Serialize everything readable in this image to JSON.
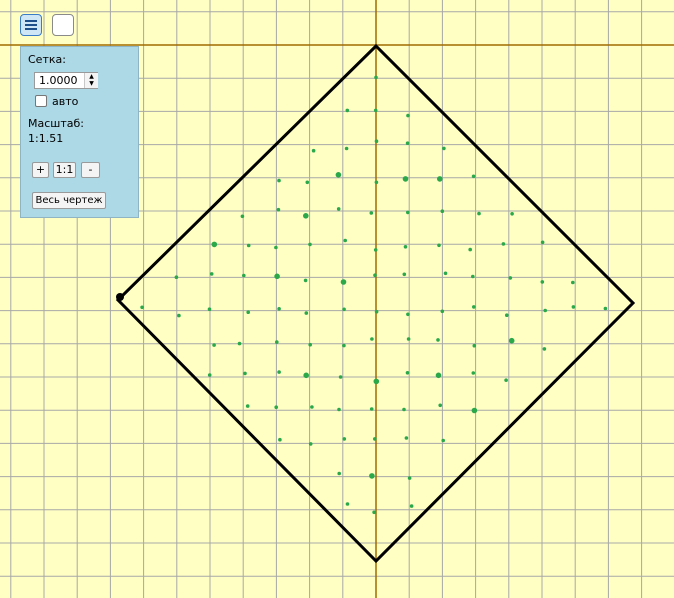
{
  "panel": {
    "grid_label": "Сетка:",
    "grid_value": "1.0000",
    "auto_label": "авто",
    "auto_checked": false,
    "scale_label": "Масштаб:",
    "scale_value": "1:1.51",
    "zoom_in_label": "+",
    "zoom_reset_label": "1:1",
    "zoom_out_label": "-",
    "fit_all_label": "Весь чертеж"
  },
  "toolbar": {
    "menu_icon": "hamburger-icon",
    "blank_icon": "empty-square-icon"
  },
  "colors": {
    "background": "#ffffc4",
    "grid_line": "#a8a8a8",
    "axis": "#a06a00",
    "shape": "#000000",
    "points": "#2aa84a",
    "panel": "#add8e6"
  },
  "drawing": {
    "shape": "square rotated 45°",
    "point_pattern": "grid of green dots inside the shape"
  }
}
